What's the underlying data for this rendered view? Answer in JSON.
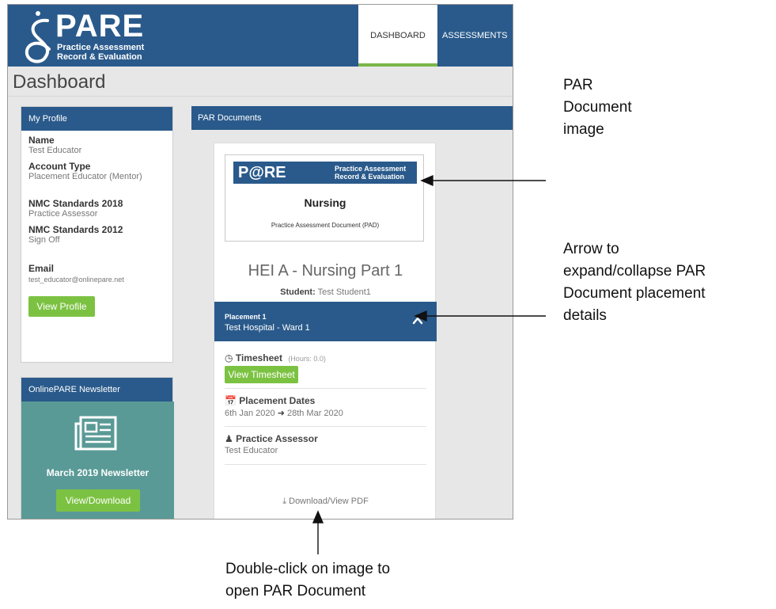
{
  "app": {
    "logo_word": "PARE",
    "logo_sub1": "Practice Assessment",
    "logo_sub2": "Record & Evaluation",
    "nav": {
      "dashboard": "DASHBOARD",
      "assessments": "ASSESSMENTS"
    },
    "page_title": "Dashboard"
  },
  "profile": {
    "header": "My Profile",
    "fields": [
      {
        "label": "Name",
        "value": "Test Educator"
      },
      {
        "label": "Account Type",
        "value": "Placement Educator (Mentor)"
      },
      {
        "label": "NMC Standards 2018",
        "value": "Practice Assessor"
      },
      {
        "label": "NMC Standards 2012",
        "value": "Sign Off"
      },
      {
        "label": "Email",
        "value": "test_educator@onlinepare.net"
      }
    ],
    "view_button": "View Profile"
  },
  "newsletter": {
    "header": "OnlinePARE Newsletter",
    "title": "March 2019 Newsletter",
    "button": "View/Download",
    "icon": "newspaper-icon"
  },
  "par_documents": {
    "header": "PAR Documents",
    "image": {
      "logo_word": "P@RE",
      "logo_sub1": "Practice Assessment",
      "logo_sub2": "Record & Evaluation",
      "subject": "Nursing",
      "doc_name": "Practice Assessment Document (PAD)"
    },
    "title": "HEI A  - Nursing Part 1",
    "student_label": "Student:",
    "student_name": "Test Student1",
    "placement": {
      "label": "Placement 1",
      "name": "Test Hospital - Ward 1",
      "timesheet_title": "Timesheet",
      "timesheet_hours": "(Hours: 0.0)",
      "timesheet_button": "View Timesheet",
      "dates_title": "Placement Dates",
      "dates_start": "6th Jan 2020",
      "dates_end": "28th Mar 2020",
      "assessor_title": "Practice Assessor",
      "assessor_name": "Test Educator"
    },
    "download": "Download/View PDF"
  },
  "annotations": {
    "par_image": [
      "PAR",
      "Document",
      "image"
    ],
    "arrow": [
      "Arrow to",
      "expand/collapse PAR",
      "Document placement",
      "details"
    ],
    "double_click": [
      "Double-click on image to",
      "open PAR Document"
    ]
  },
  "colors": {
    "brand_blue": "#2a5a8b",
    "green_button": "#7cc242",
    "newsletter_teal": "#5a9a96"
  }
}
